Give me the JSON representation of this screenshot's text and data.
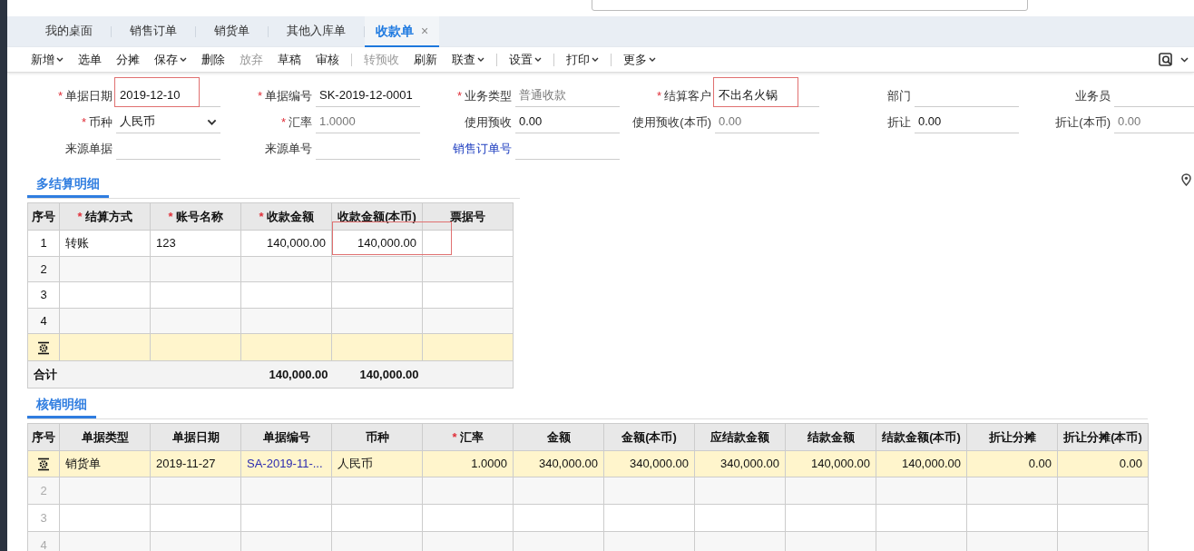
{
  "tabs": [
    {
      "label": "我的桌面",
      "selected": false
    },
    {
      "label": "销售订单",
      "selected": false
    },
    {
      "label": "销货单",
      "selected": false
    },
    {
      "label": "其他入库单",
      "selected": false
    },
    {
      "label": "收款单",
      "selected": true,
      "close": "×"
    }
  ],
  "toolbar": [
    [
      {
        "label": "新增",
        "dropdown": true,
        "disabled": false
      },
      {
        "label": "选单",
        "dropdown": false,
        "disabled": false
      },
      {
        "label": "分摊",
        "dropdown": false,
        "disabled": false
      },
      {
        "label": "保存",
        "dropdown": true,
        "disabled": false
      },
      {
        "label": "删除",
        "dropdown": false,
        "disabled": false
      },
      {
        "label": "放弃",
        "dropdown": false,
        "disabled": true
      },
      {
        "label": "草稿",
        "dropdown": false,
        "disabled": false
      },
      {
        "label": "审核",
        "dropdown": false,
        "disabled": false
      }
    ],
    [
      {
        "label": "转预收",
        "dropdown": false,
        "disabled": true
      },
      {
        "label": "刷新",
        "dropdown": false,
        "disabled": false
      },
      {
        "label": "联查",
        "dropdown": true,
        "disabled": false
      }
    ],
    [
      {
        "label": "设置",
        "dropdown": true,
        "disabled": false
      }
    ],
    [
      {
        "label": "打印",
        "dropdown": true,
        "disabled": false
      }
    ],
    [
      {
        "label": "更多",
        "dropdown": true,
        "disabled": false
      }
    ]
  ],
  "form": [
    [
      {
        "mark": "*",
        "label": "单据日期",
        "value": "2019-12-10",
        "kind": "text",
        "readonly": false,
        "highlighted": true
      },
      {
        "mark": "*",
        "label": "单据编号",
        "value": "SK-2019-12-0001",
        "kind": "text",
        "readonly": false
      },
      {
        "mark": "*",
        "label": "业务类型",
        "value": "普通收款",
        "kind": "text",
        "readonly": true
      },
      {
        "mark": "*",
        "label": "结算客户",
        "value": "不出名火锅",
        "kind": "text",
        "readonly": false,
        "highlighted": true
      },
      {
        "label": "部门",
        "kind": "text"
      },
      {
        "label": "业务员",
        "kind": "text"
      }
    ],
    [
      {
        "mark": "*",
        "label": "币种",
        "value": "人民币",
        "kind": "select",
        "readonly": false
      },
      {
        "mark": "*",
        "label": "汇率",
        "value": "1.0000",
        "kind": "text",
        "readonly": true
      },
      {
        "label": "使用预收",
        "value": "0.00",
        "kind": "text",
        "readonly": false
      },
      {
        "label": "使用预收(本币)",
        "value": "0.00",
        "kind": "text",
        "readonly": true
      },
      {
        "label": "折让",
        "value": "0.00",
        "kind": "text",
        "readonly": false
      },
      {
        "label": "折让(本币)",
        "value": "0.00",
        "kind": "text",
        "readonly": true
      }
    ],
    [
      {
        "label": "来源单据",
        "kind": "text"
      },
      {
        "label": "来源单号",
        "kind": "text"
      },
      {
        "label": "销售订单号",
        "kind": "link"
      }
    ]
  ],
  "settlement": {
    "title": "多结算明细",
    "columns": [
      {
        "label": "序号"
      },
      {
        "mark": "*",
        "label": "结算方式",
        "kind": "text"
      },
      {
        "mark": "*",
        "label": "账号名称",
        "kind": "text"
      },
      {
        "mark": "*",
        "label": "收款金额",
        "kind": "amount"
      },
      {
        "label": "收款金额(本币)",
        "kind": "amount"
      },
      {
        "label": "票据号",
        "kind": "text"
      }
    ],
    "rows": [
      {
        "kind": "data",
        "no": "1",
        "cells": [
          {
            "text": "转账"
          },
          {
            "text": "123"
          },
          {
            "text": "140,000.00"
          },
          {
            "text": "140,000.00",
            "highlighted": true
          }
        ]
      },
      {
        "kind": "data",
        "no": "2"
      },
      {
        "kind": "data",
        "no": "3"
      },
      {
        "kind": "data",
        "no": "4"
      },
      {
        "kind": "add"
      }
    ],
    "total": {
      "label": "合计",
      "amounts": [
        "140,000.00",
        "140,000.00"
      ]
    }
  },
  "writeoff": {
    "title": "核销明细",
    "columns": [
      {
        "label": "序号"
      },
      {
        "label": "单据类型",
        "kind": "text"
      },
      {
        "label": "单据日期",
        "kind": "text"
      },
      {
        "label": "单据编号",
        "kind": "link"
      },
      {
        "label": "币种",
        "kind": "text"
      },
      {
        "mark": "*",
        "label": "汇率",
        "kind": "amount"
      },
      {
        "label": "金额",
        "kind": "amount"
      },
      {
        "label": "金额(本币)",
        "kind": "amount"
      },
      {
        "label": "应结款金额",
        "kind": "amount"
      },
      {
        "label": "结款金额",
        "kind": "amount"
      },
      {
        "label": "结款金额(本币)",
        "kind": "amount"
      },
      {
        "label": "折让分摊",
        "kind": "amount"
      },
      {
        "label": "折让分摊(本币)",
        "kind": "amount"
      }
    ],
    "rows": [
      {
        "selected": true,
        "cells": [
          "销货单",
          "2019-11-27",
          "SA-2019-11-...",
          "人民币",
          "1.0000",
          "340,000.00",
          "340,000.00",
          "340,000.00",
          "140,000.00",
          "140,000.00",
          "0.00",
          "0.00"
        ]
      },
      {
        "selected": false,
        "no": "2"
      },
      {
        "selected": false,
        "no": "3"
      },
      {
        "selected": false,
        "no": "4"
      }
    ]
  }
}
